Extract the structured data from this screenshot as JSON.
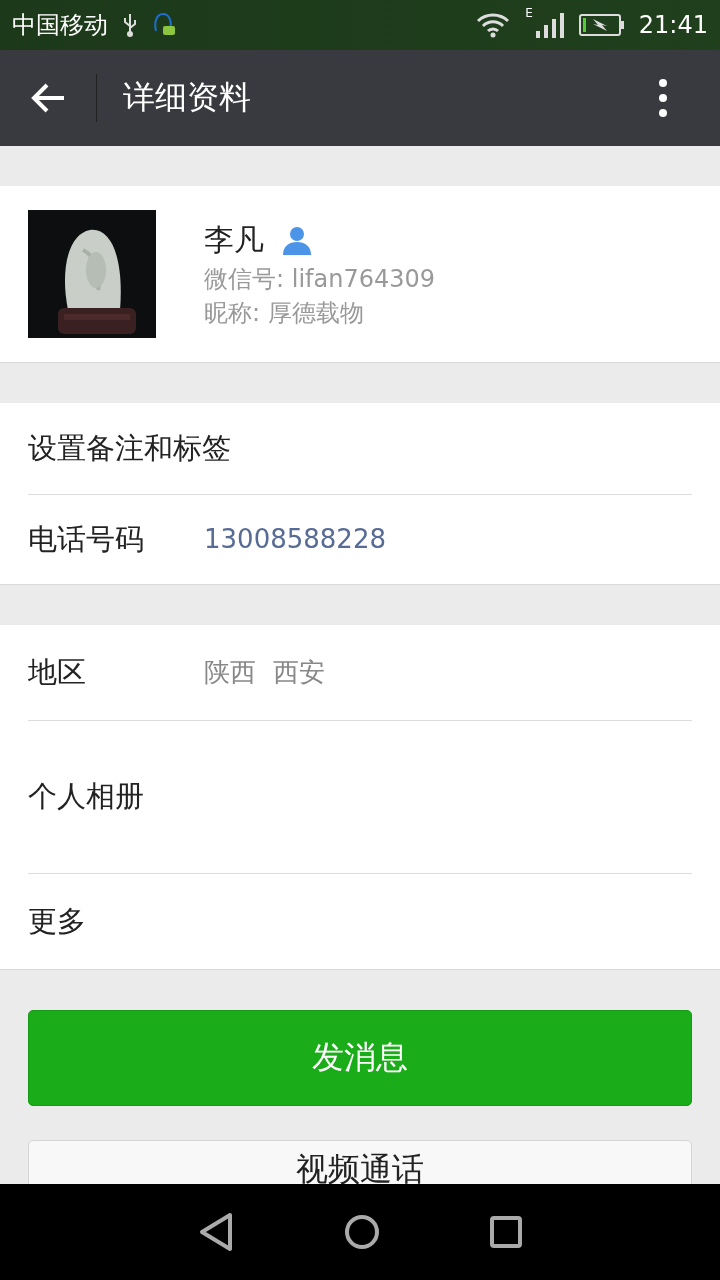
{
  "status_bar": {
    "carrier": "中国移动",
    "network": "E",
    "time": "21:41"
  },
  "toolbar": {
    "title": "详细资料"
  },
  "profile": {
    "kind": "picture",
    "name": "李凡",
    "wechat_id": "微信号: lifan764309",
    "nickname": "昵称: 厚德载物"
  },
  "groups": [
    [
      {
        "label": "设置备注和标签"
      },
      {
        "label": "电话号码",
        "value": "13008588228",
        "kind": "link"
      }
    ],
    [
      {
        "label": "地区",
        "value": "陕西  西安",
        "kind": "plain"
      },
      {
        "label": "个人相册",
        "kind": "album"
      },
      {
        "label": "更多"
      }
    ]
  ],
  "buttons": [
    {
      "label": "发消息",
      "kind": "primary"
    },
    {
      "label": "视频通话",
      "kind": "secondary"
    }
  ]
}
